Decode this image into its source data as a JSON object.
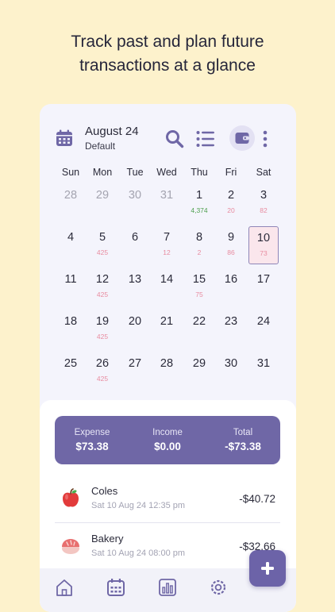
{
  "headline": {
    "line1": "Track past and plan future",
    "line2": "transactions at a glance"
  },
  "header": {
    "month": "August 24",
    "book": "Default",
    "icons": [
      "calendar-icon",
      "search-icon",
      "list-icon",
      "wallet-icon",
      "more-vertical-icon"
    ]
  },
  "weekdays": [
    "Sun",
    "Mon",
    "Tue",
    "Wed",
    "Thu",
    "Fri",
    "Sat"
  ],
  "calendar": [
    [
      {
        "day": "28",
        "muted": true
      },
      {
        "day": "29",
        "muted": true
      },
      {
        "day": "30",
        "muted": true
      },
      {
        "day": "31",
        "muted": true
      },
      {
        "day": "1",
        "value": "4,374",
        "positive": true
      },
      {
        "day": "2",
        "value": "20"
      },
      {
        "day": "3",
        "value": "82"
      }
    ],
    [
      {
        "day": "4"
      },
      {
        "day": "5",
        "value": "425"
      },
      {
        "day": "6"
      },
      {
        "day": "7",
        "value": "12"
      },
      {
        "day": "8",
        "value": "2"
      },
      {
        "day": "9",
        "value": "86"
      },
      {
        "day": "10",
        "value": "73",
        "selected": true
      }
    ],
    [
      {
        "day": "11"
      },
      {
        "day": "12",
        "value": "425"
      },
      {
        "day": "13"
      },
      {
        "day": "14"
      },
      {
        "day": "15",
        "value": "75"
      },
      {
        "day": "16"
      },
      {
        "day": "17"
      }
    ],
    [
      {
        "day": "18"
      },
      {
        "day": "19",
        "value": "425"
      },
      {
        "day": "20"
      },
      {
        "day": "21"
      },
      {
        "day": "22"
      },
      {
        "day": "23"
      },
      {
        "day": "24"
      }
    ],
    [
      {
        "day": "25"
      },
      {
        "day": "26",
        "value": "425"
      },
      {
        "day": "27"
      },
      {
        "day": "28"
      },
      {
        "day": "29"
      },
      {
        "day": "30"
      },
      {
        "day": "31"
      }
    ]
  ],
  "summary": {
    "expense_label": "Expense",
    "expense_value": "$73.38",
    "income_label": "Income",
    "income_value": "$0.00",
    "total_label": "Total",
    "total_value": "-$73.38"
  },
  "transactions": [
    {
      "name": "Coles",
      "date": "Sat 10 Aug 24 12:35 pm",
      "amount": "-$40.72",
      "icon": "apple-icon"
    },
    {
      "name": "Bakery",
      "date": "Sat 10 Aug 24 08:00 pm",
      "amount": "-$32.66",
      "icon": "bread-icon"
    }
  ],
  "nav": [
    "home-icon",
    "calendar-icon",
    "chart-icon",
    "settings-icon"
  ],
  "colors": {
    "background": "#fdf2cc",
    "accent": "#6f67a6",
    "expense_value": "#e88ca0",
    "income_value": "#4fa04f"
  }
}
